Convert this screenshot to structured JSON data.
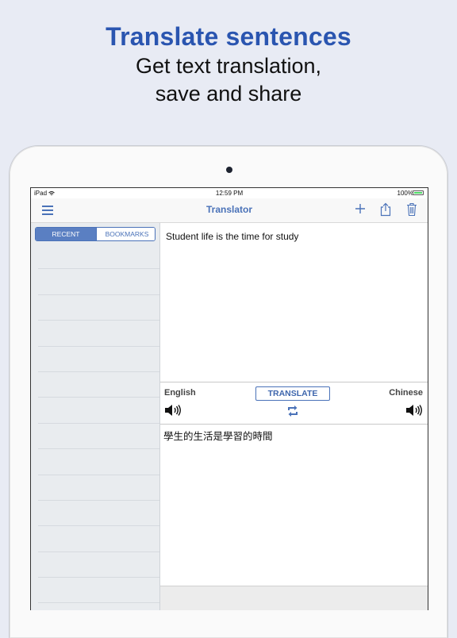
{
  "promo": {
    "title": "Translate sentences",
    "subtitle_line1": "Get text translation,",
    "subtitle_line2": "save and share"
  },
  "status": {
    "device": "iPad",
    "time": "12:59 PM",
    "battery": "100%"
  },
  "navbar": {
    "title": "Translator",
    "icons": [
      "menu-icon",
      "plus-icon",
      "share-icon",
      "trash-icon"
    ]
  },
  "sidebar": {
    "tabs": [
      {
        "label": "RECENT",
        "selected": true
      },
      {
        "label": "BOOKMARKS",
        "selected": false
      }
    ]
  },
  "translator": {
    "input_text": "Student life is the time for study",
    "source_language": "English",
    "target_language": "Chinese",
    "translate_label": "TRANSLATE",
    "output_text": "學生的生活是學習的時間"
  },
  "colors": {
    "accent": "#4a72b8",
    "promo_title": "#2a55b0",
    "background": "#e8ebf4"
  }
}
